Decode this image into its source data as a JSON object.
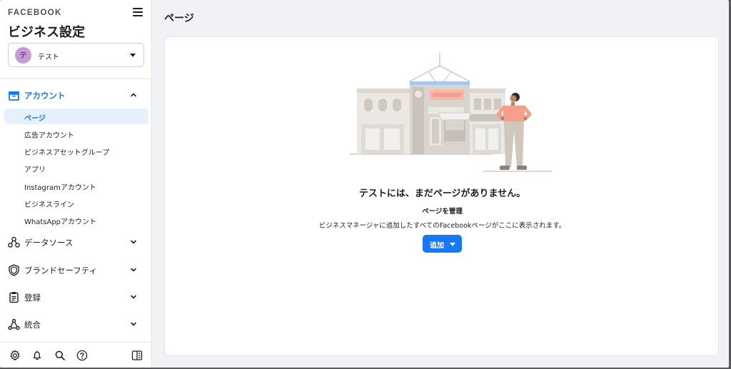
{
  "brand": "FACEBOOK",
  "sidebar": {
    "title": "ビジネス設定",
    "account": {
      "avatar_letter": "テ",
      "name": "テスト"
    },
    "sections": {
      "account": "アカウント",
      "data_sources": "データソース",
      "brand_safety": "ブランドセーフティ",
      "registration": "登録",
      "integration": "統合"
    },
    "items": [
      "ページ",
      "広告アカウント",
      "ビジネスアセットグループ",
      "アプリ",
      "Instagramアカウント",
      "ビジネスライン",
      "WhatsAppアカウント"
    ]
  },
  "main": {
    "heading": "ページ",
    "empty_title": "テストには、まだページがありません。",
    "manage_label": "ページを管理",
    "description": "ビジネスマネージャに追加したすべてのFacebookページがここに表示されます。",
    "add_button": "追加"
  },
  "colors": {
    "accent": "#1877f2",
    "selected_bg": "#e7f0fd"
  }
}
